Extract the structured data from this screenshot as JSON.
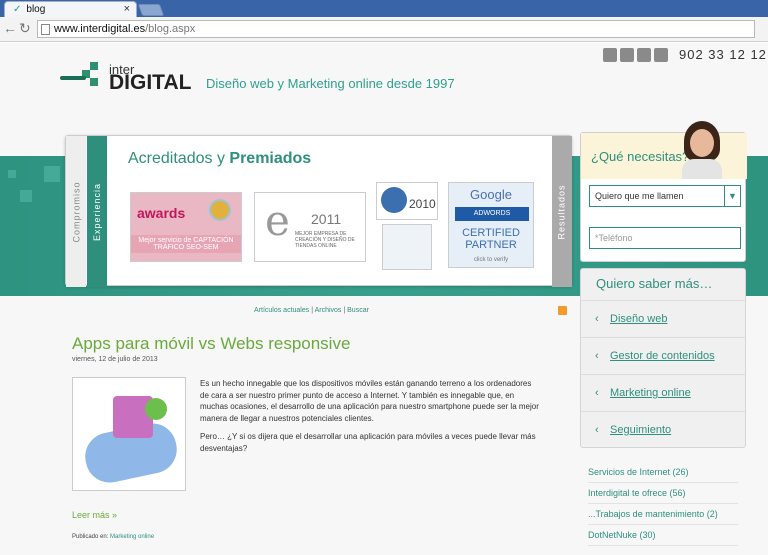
{
  "browser": {
    "tab_title": "blog",
    "tab_close": "×",
    "url_domain": "www.interdigital.es",
    "url_path": "/blog.aspx"
  },
  "header": {
    "phone": "902 33 12 12",
    "logo_top": "inter",
    "logo_bottom": "DIGITAL",
    "tagline": "Diseño web y Marketing online desde 1997"
  },
  "banner": {
    "strip_1": "Compromiso",
    "strip_2": "Experiencia",
    "strip_3": "Resultados",
    "title_light": "Acreditados y ",
    "title_bold": "Premiados",
    "award1_head": "awards",
    "award1_foot": "Mejor servicio de CAPTACIÓN TRÁFICO SEO-SEM",
    "award2_year": "2011",
    "award2_foot": "MEJOR EMPRESA DE CREACIÓN Y DISEÑO DE TIENDAS ONLINE",
    "award3_year": "2010",
    "award5_google": "Google",
    "award5_adwords": "ADWORDS",
    "award5_certified": "CERTIFIED PARTNER",
    "award5_verify": "click to verify"
  },
  "contact": {
    "question": "¿Qué necesitas?",
    "select_value": "Quiero que me llamen",
    "phone_placeholder": "*Teléfono"
  },
  "menu": {
    "title": "Quiero saber más…",
    "items": [
      {
        "label": "Diseño web"
      },
      {
        "label": "Gestor de contenidos"
      },
      {
        "label": "Marketing online"
      },
      {
        "label": "Seguimiento"
      }
    ]
  },
  "categories": [
    "Servicios de Internet (26)",
    "Interdigital te ofrece (56)",
    "...Trabajos de mantenimiento (2)",
    "DotNetNuke (30)"
  ],
  "blog": {
    "link_current": "Artículos actuales",
    "link_archive": "Archivos",
    "link_search": "Buscar",
    "post_title": "Apps para móvil vs Webs responsive",
    "post_date": "viernes, 12 de julio de 2013",
    "para1": "Es un hecho innegable que los dispositivos móviles están ganando terreno a los ordenadores de cara a ser nuestro primer punto de acceso a Internet. Y también es innegable que, en muchas ocasiones, el desarrollo de una aplicación para nuestro smartphone puede ser la mejor manera de llegar a nuestros potenciales clientes.",
    "para2": "Pero… ¿Y si os dijera que el desarrollar una aplicación para móviles a veces puede llevar más desventajas?",
    "read_more": "Leer más »",
    "published_label": "Publicado en: ",
    "published_category": "Marketing online"
  },
  "colors": {
    "brand_green": "#2e8f7c",
    "post_green": "#6aa93c"
  }
}
